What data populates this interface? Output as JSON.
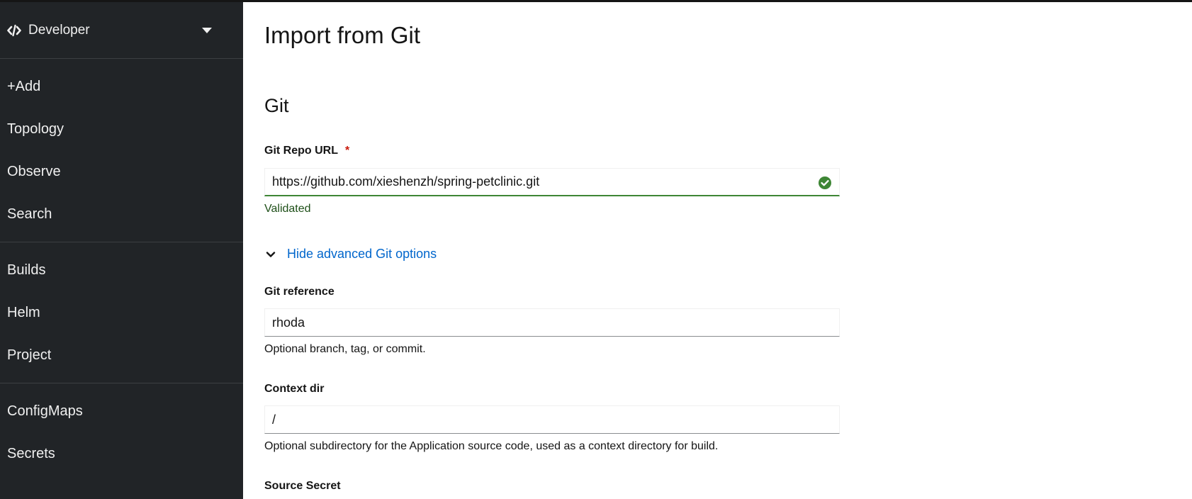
{
  "sidebar": {
    "perspective": {
      "label": "Developer",
      "icon": "code-icon"
    },
    "groups": [
      [
        "+Add",
        "Topology",
        "Observe",
        "Search"
      ],
      [
        "Builds",
        "Helm",
        "Project"
      ],
      [
        "ConfigMaps",
        "Secrets"
      ]
    ]
  },
  "page": {
    "title": "Import from Git",
    "section": "Git"
  },
  "form": {
    "repo_url": {
      "label": "Git Repo URL",
      "required_marker": "*",
      "value": "https://github.com/xieshenzh/spring-petclinic.git",
      "status": "Validated",
      "status_icon": "check-circle-icon"
    },
    "advanced_toggle": {
      "label": "Hide advanced Git options",
      "icon": "chevron-down-icon"
    },
    "git_reference": {
      "label": "Git reference",
      "value": "rhoda",
      "helper": "Optional branch, tag, or commit."
    },
    "context_dir": {
      "label": "Context dir",
      "value": "/",
      "helper": "Optional subdirectory for the Application source code, used as a context directory for build."
    },
    "source_secret": {
      "label": "Source Secret"
    }
  },
  "colors": {
    "sidebar_bg": "#212427",
    "success": "#3e8635",
    "link": "#0066cc",
    "required": "#c9190b"
  }
}
